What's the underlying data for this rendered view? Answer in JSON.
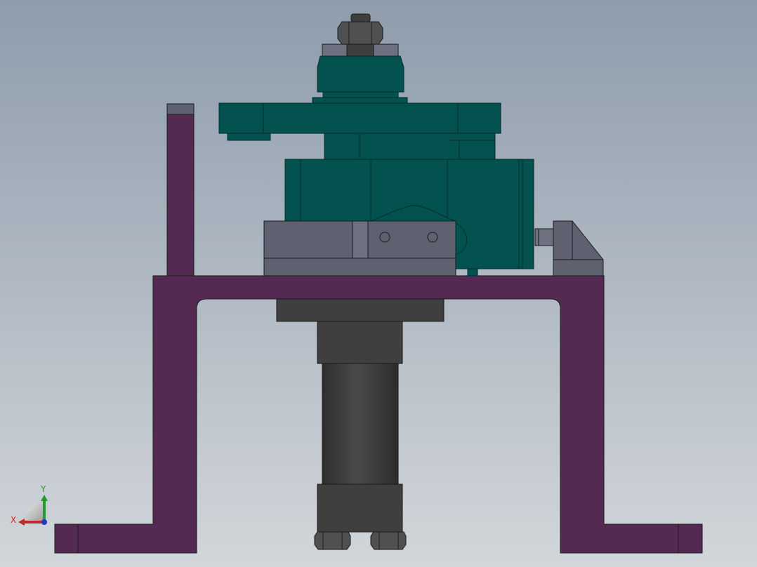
{
  "viewport": {
    "background_top": "#8E9CAC",
    "background_bottom": "#D2D6DA"
  },
  "colors": {
    "frame": "#542A52",
    "frame_dark": "#3C1C3A",
    "teal": "#03524F",
    "teal_edge": "#022E2C",
    "gray_part": "#5F6170",
    "gray_light": "#6E7180",
    "cylinder_dark": "#3F3F3F",
    "cylinder_mid": "#505050",
    "edge": "#1A1A1A"
  },
  "triad": {
    "x_label": "X",
    "y_label": "Y",
    "x_color": "#C0282C",
    "y_color": "#1E9E2E",
    "z_color": "#1E38C8"
  }
}
